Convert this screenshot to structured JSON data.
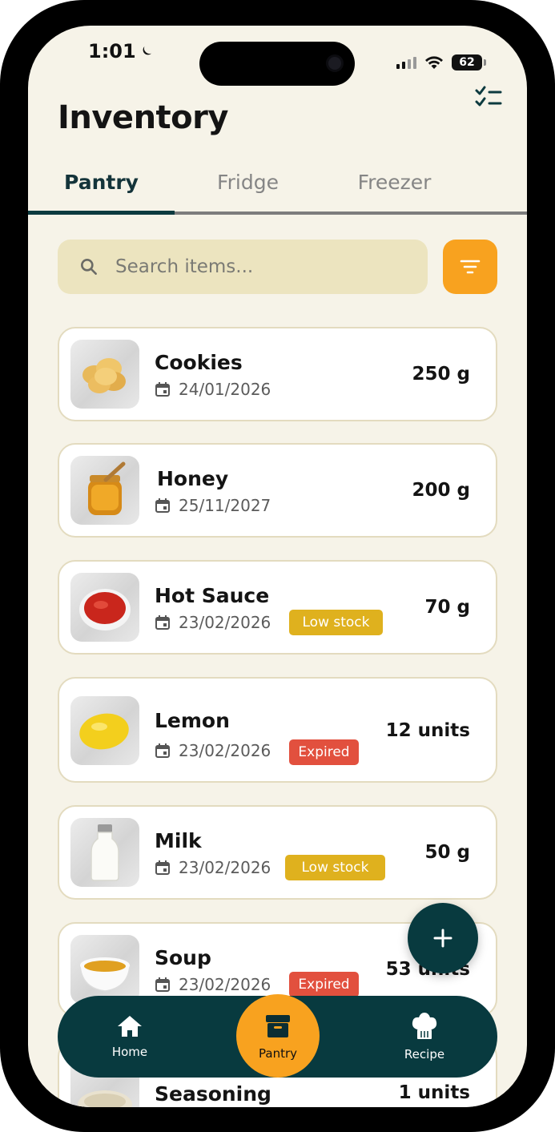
{
  "status_bar": {
    "time": "1:01",
    "battery": "62"
  },
  "page": {
    "title": "Inventory"
  },
  "tabs": [
    {
      "label": "Pantry"
    },
    {
      "label": "Fridge"
    },
    {
      "label": "Freezer"
    }
  ],
  "search": {
    "placeholder": "Search items..."
  },
  "items": [
    {
      "name": "Cookies",
      "date": "24/01/2026",
      "qty": "250 g",
      "badge": ""
    },
    {
      "name": "Honey",
      "date": "25/11/2027",
      "qty": "200 g",
      "badge": ""
    },
    {
      "name": "Hot Sauce",
      "date": "23/02/2026",
      "qty": "70 g",
      "badge": "Low stock"
    },
    {
      "name": "Lemon",
      "date": "23/02/2026",
      "qty": "12 units",
      "badge": "Expired"
    },
    {
      "name": "Milk",
      "date": "23/02/2026",
      "qty": "50 g",
      "badge": "Low stock"
    },
    {
      "name": "Soup",
      "date": "23/02/2026",
      "qty": "53 units",
      "badge": "Expired"
    },
    {
      "name": "Seasoning",
      "date": "",
      "qty": "1 units",
      "badge": ""
    }
  ],
  "bottom_nav": [
    {
      "label": "Home",
      "icon": "home-icon"
    },
    {
      "label": "Pantry",
      "icon": "box-icon"
    },
    {
      "label": "Recipe",
      "icon": "chef-hat-icon"
    }
  ],
  "colors": {
    "background": "#f6f3e8",
    "primary_dark": "#083a3f",
    "accent": "#f8a21f",
    "low_stock": "#dfb11e",
    "expired": "#e2503e"
  }
}
